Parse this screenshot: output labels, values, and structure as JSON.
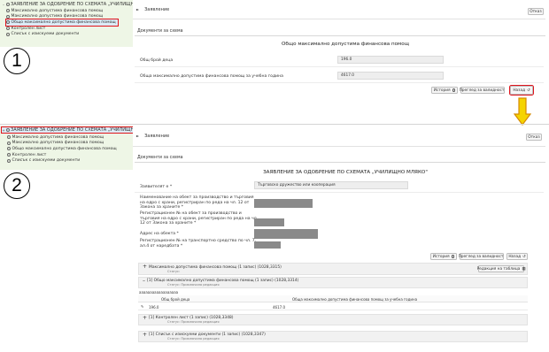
{
  "colors": {
    "tree_bg": "#eef6e6",
    "highlight": "#e0141c",
    "arrow": "#f5d400",
    "arrow_outline": "#d58a00"
  },
  "panel1": {
    "tree": {
      "root_label": "ЗАЯВЛЕНИЕ ЗА ОДОБРЕНИЕ ПО СХЕМАТА „УЧИЛИЩНО МЛЯКО\"",
      "items": [
        "Максимално допустима финансова помощ",
        "Максимално допустима финансова помощ",
        "Общо максимално допустима финансова помощ",
        "Контролен лист",
        "Списък с изискуеми документи"
      ],
      "selected_index": 2
    },
    "marker": "1",
    "header": {
      "title": "Заявление",
      "close_label": "Отказ"
    },
    "section_title": "Документи за схема",
    "form_title": "Общо максимално допустима финансова помощ",
    "fields": [
      {
        "label": "Общ брой деца",
        "value": "196.0"
      },
      {
        "label": "Обща максимално допустима финансова помощ за учебна година",
        "value": "4617.0"
      }
    ],
    "buttons": {
      "history": "История",
      "validity": "Преглед за валидност",
      "back": "Назад"
    }
  },
  "panel2": {
    "tree": {
      "root_label": "ЗАЯВЛЕНИЕ ЗА ОДОБРЕНИЕ ПО СХЕМАТА „УЧИЛИЩНО МЛЯКО\"",
      "items": [
        "Максимално допустима финансова помощ",
        "Максимално допустима финансова помощ",
        "Общо максимално допустима финансова помощ",
        "Контролен лист",
        "Списък с изискуеми документи"
      ]
    },
    "marker": "2",
    "header": {
      "title": "Заявление",
      "close_label": "Отказ"
    },
    "section_title": "Документи за схема",
    "form_title": "ЗАЯВЛЕНИЕ ЗА ОДОБРЕНИЕ ПО СХЕМАТА „УЧИЛИЩНО МЛЯКО\"",
    "fields": [
      {
        "label": "Заявителят е *",
        "value": "Търговско дружество или кооперация"
      },
      {
        "label": "Наименование на обект за производство и търговия на едро с храни, регистриран по реда на чл. 12 от Закона за храните *",
        "value": ""
      },
      {
        "label": "Регистрационен № на обект за производство и търговия на едро с храни, регистриран по реда на чл. 12 от Закона за храните *",
        "value": ""
      },
      {
        "label": "Адрес на обекта *",
        "value": ""
      },
      {
        "label": "Регистрационен № на транспортно средство по чл. 7, ал.4 от наредбата *",
        "value": ""
      }
    ],
    "buttons": {
      "history": "История",
      "validity": "Преглед за валидност",
      "back": "Назад",
      "edit_table": "Редакция на таблица"
    },
    "subsections": [
      {
        "title": "Максимално допустима финансова помощ (1 запис) (1028,3315)",
        "status": "Статус:",
        "expanded": false
      },
      {
        "title": "[1] Общо максимално допустима финансова помощ (1 запис) (1028,3314)",
        "status": "Статус: Приключила редакция",
        "expanded": true
      },
      {
        "title": "[1] Контролен лист (1 запис) (1028,3348)",
        "status": "Статус: Приключила редакция",
        "expanded": false
      },
      {
        "title": "[1] Списък с изискуеми документи (1 запис) (1028,3347)",
        "status": "Статус: Приключила редакция",
        "expanded": false
      }
    ],
    "garbled_text": "аааааааааааааааааа",
    "table": {
      "columns": [
        "Общ брой деца",
        "Обща максимално допустима финансова помощ за учебна година"
      ],
      "rows": [
        [
          "196.0",
          "4617.0"
        ]
      ]
    }
  }
}
